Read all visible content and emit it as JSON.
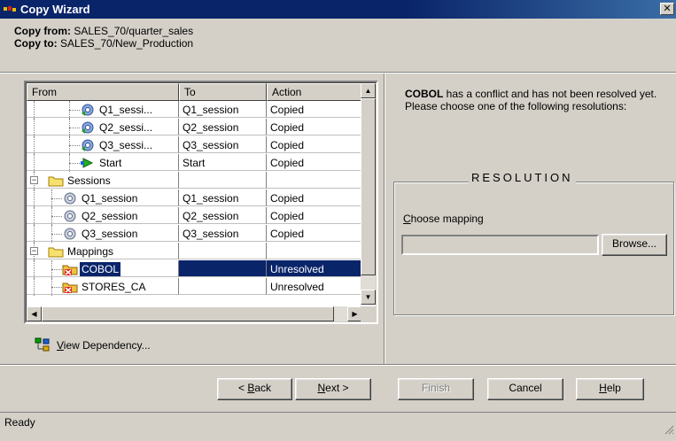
{
  "window": {
    "title": "Copy Wizard",
    "close_glyph": "✕"
  },
  "header": {
    "copy_from_label": "Copy from:",
    "copy_from_value": "SALES_70/quarter_sales",
    "copy_to_label": "Copy to:",
    "copy_to_value": "SALES_70/New_Production"
  },
  "table": {
    "columns": [
      "From",
      "To",
      "Action"
    ],
    "rows": [
      {
        "from": "Q1_sessi...",
        "to": "Q1_session",
        "action": "Copied",
        "icon": "session-instance-icon"
      },
      {
        "from": "Q2_sessi...",
        "to": "Q2_session",
        "action": "Copied",
        "icon": "session-instance-icon"
      },
      {
        "from": "Q3_sessi...",
        "to": "Q3_session",
        "action": "Copied",
        "icon": "session-instance-icon"
      },
      {
        "from": "Start",
        "to": "Start",
        "action": "Copied",
        "icon": "start-icon"
      },
      {
        "from": "Sessions",
        "to": "",
        "action": "",
        "icon": "folder-icon",
        "expander": "−"
      },
      {
        "from": "Q1_session",
        "to": "Q1_session",
        "action": "Copied",
        "icon": "session-icon"
      },
      {
        "from": "Q2_session",
        "to": "Q2_session",
        "action": "Copied",
        "icon": "session-icon"
      },
      {
        "from": "Q3_session",
        "to": "Q3_session",
        "action": "Copied",
        "icon": "session-icon"
      },
      {
        "from": "Mappings",
        "to": "",
        "action": "",
        "icon": "folder-icon",
        "expander": "−"
      },
      {
        "from": "COBOL",
        "to": "",
        "action": "Unresolved",
        "icon": "mapping-conflict-icon",
        "selected": true
      },
      {
        "from": "STORES_CA",
        "to": "",
        "action": "Unresolved",
        "icon": "mapping-conflict-icon"
      }
    ]
  },
  "view_dependency": {
    "label_ul": "V",
    "label_rest": "iew Dependency..."
  },
  "conflict": {
    "object": "COBOL",
    "message": " has a conflict and has not been resolved yet. Please choose one of the following resolutions:"
  },
  "resolution": {
    "title": "RESOLUTION",
    "choose_label_ul": "C",
    "choose_label_rest": "hoose mapping",
    "mapping_value": "",
    "browse_label": "Browse..."
  },
  "buttons": {
    "back_prefix": "< ",
    "back_ul": "B",
    "back_rest": "ack",
    "next_ul": "N",
    "next_rest": "ext >",
    "finish": "Finish",
    "cancel": "Cancel",
    "help_ul": "H",
    "help_rest": "elp"
  },
  "status": {
    "text": "Ready"
  },
  "colors": {
    "titlebar": "#0a246a",
    "selection": "#0a246a",
    "face": "#d4d0c8"
  }
}
